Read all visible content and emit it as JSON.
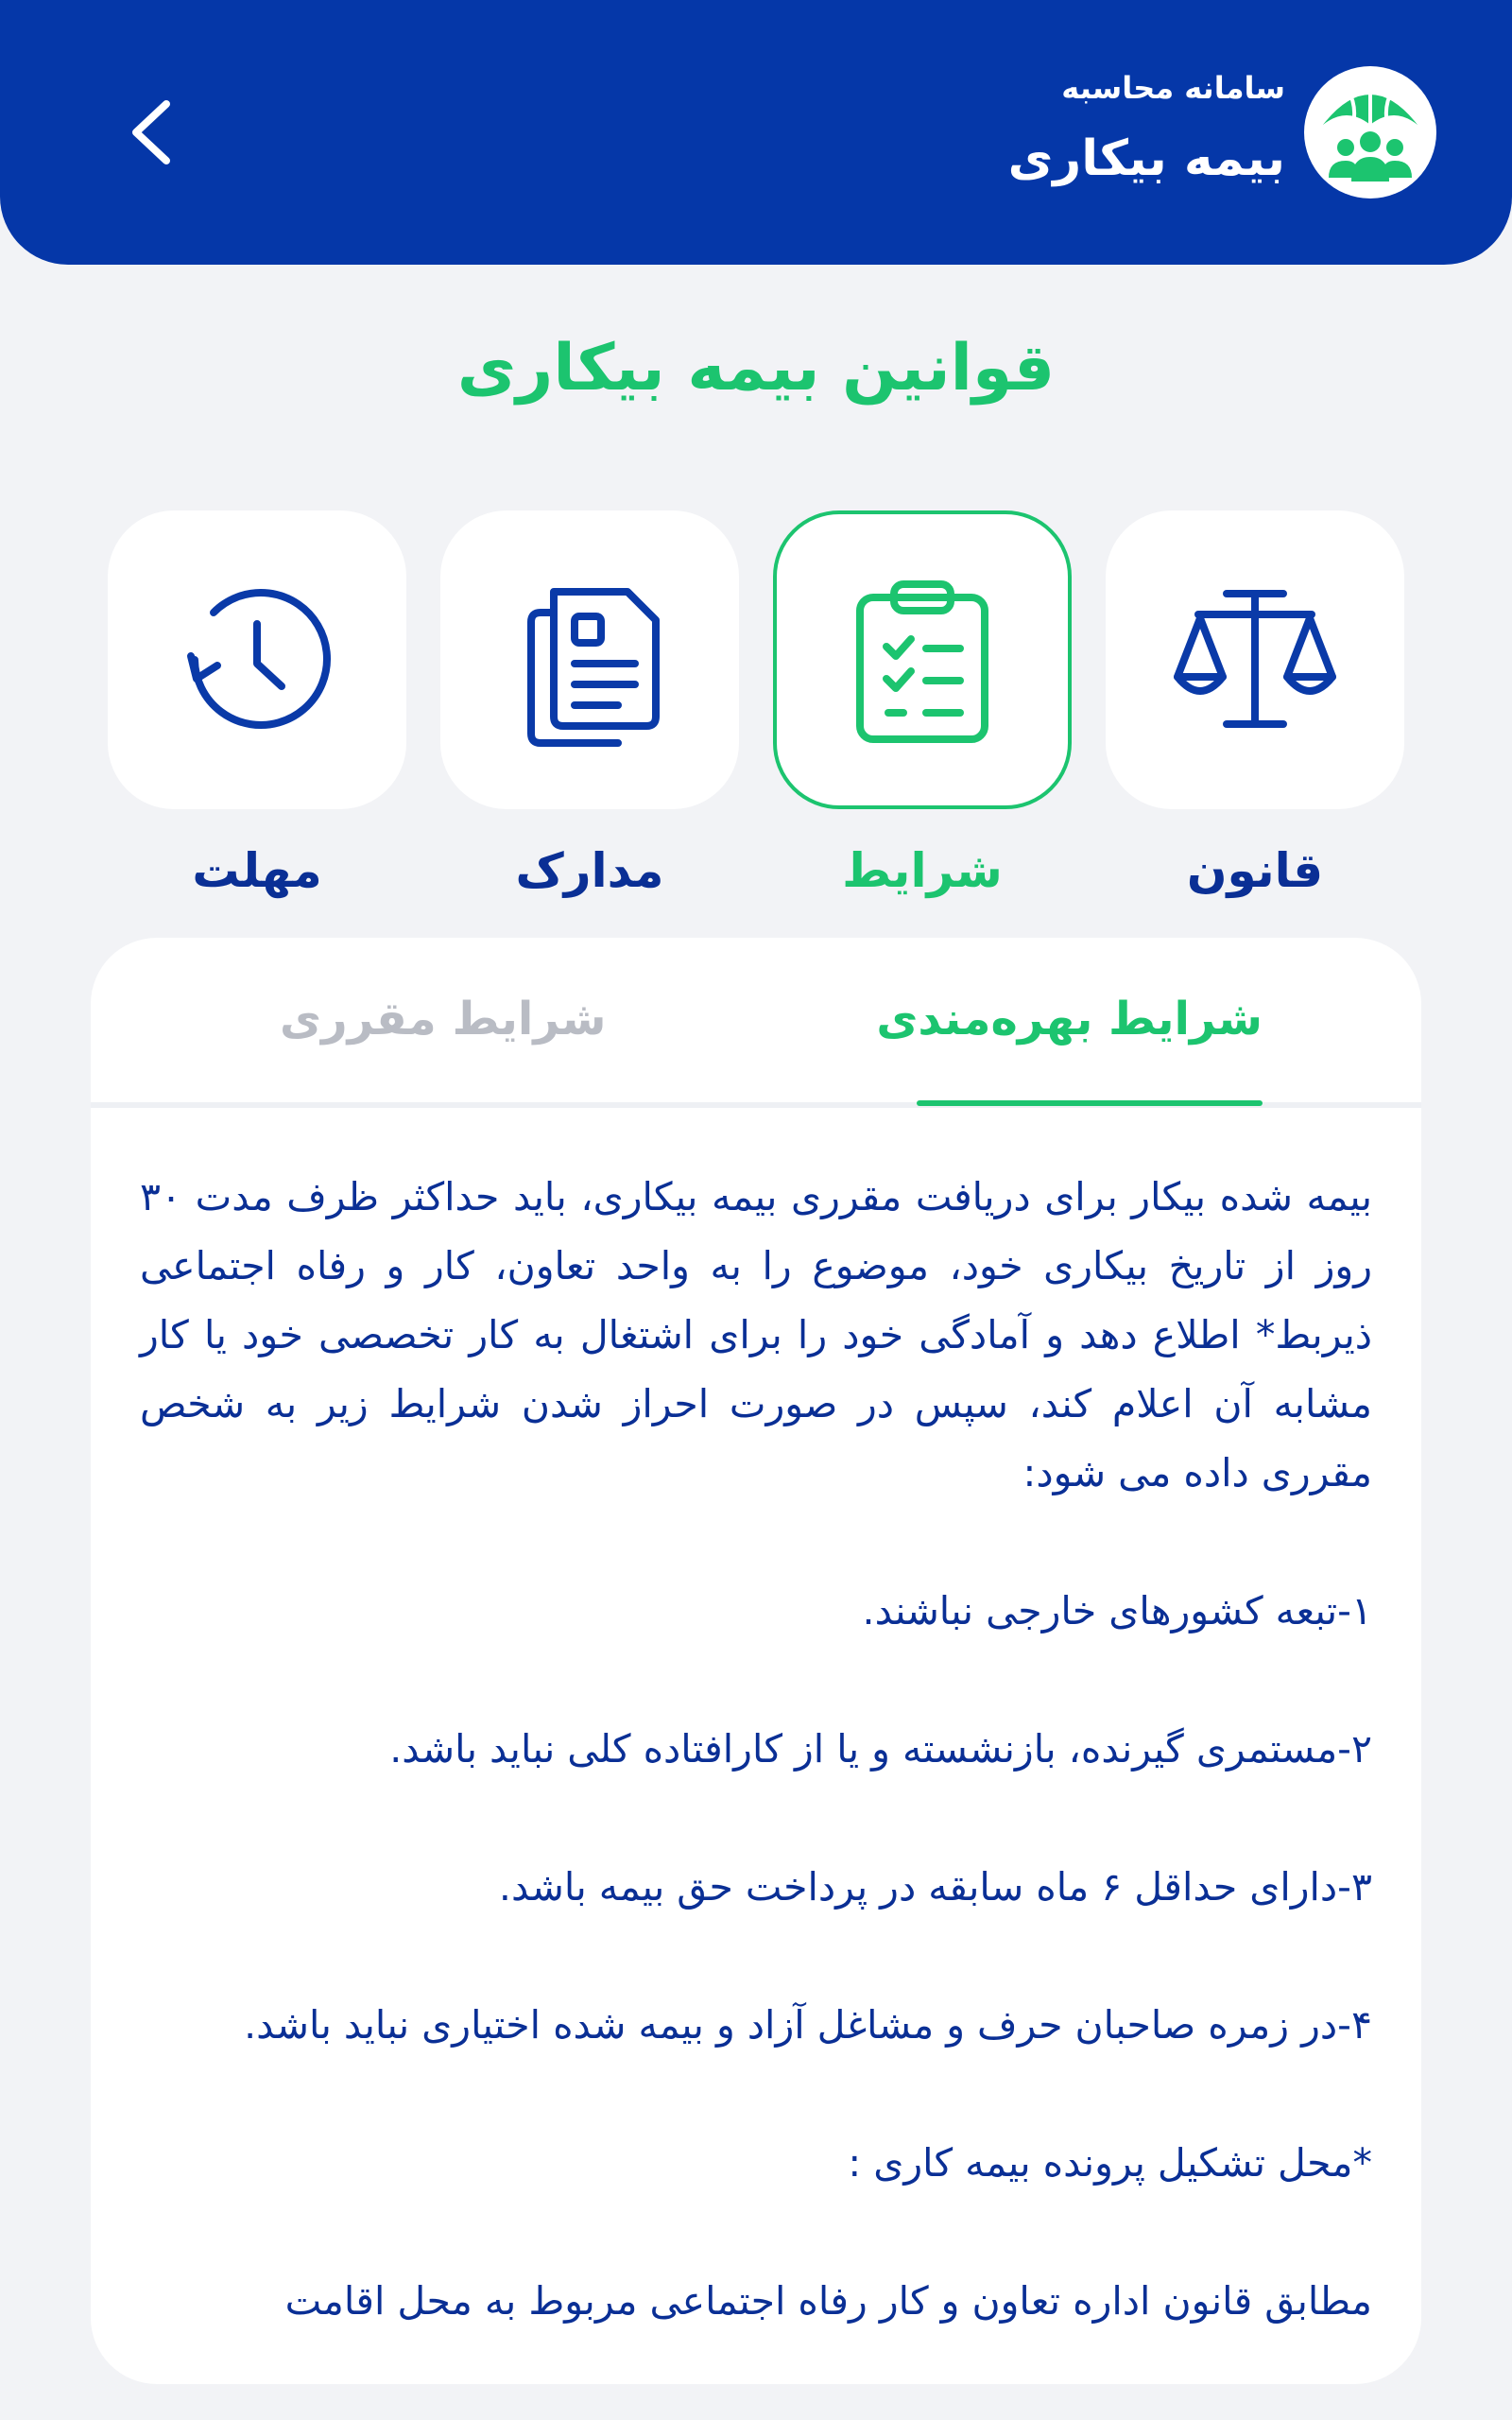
{
  "header": {
    "subtitle": "سامانه محاسبه",
    "title": "بیمه بیکاری"
  },
  "page": {
    "title": "قوانین بیمه بیکاری"
  },
  "categories": [
    {
      "label": "قانون",
      "icon": "scale-icon",
      "active": false
    },
    {
      "label": "شرایط",
      "icon": "clipboard-checklist-icon",
      "active": true
    },
    {
      "label": "مدارک",
      "icon": "documents-icon",
      "active": false
    },
    {
      "label": "مهلت",
      "icon": "history-clock-icon",
      "active": false
    }
  ],
  "tabs": {
    "active": "شرایط بهره‌مندی",
    "inactive": "شرایط مقرری"
  },
  "content": {
    "intro": "بیمه شده بیکار برای دریافت مقرری بیمه بیکاری، باید حداکثر ظرف مدت ۳۰ روز از تاریخ بیکاری خود، موضوع را به واحد تعاون، کار و رفاه اجتماعی ذیربط* اطلاع دهد و آمادگی خود را برای اشتغال به کار تخصصی خود یا کار مشابه آن اعلام کند، سپس در صورت احراز شدن شرایط زیر به شخص مقرری داده می شود:",
    "items": [
      "۱-تبعه کشورهای خارجی نباشند.",
      "۲-مستمری گیرنده، بازنشسته و یا از کارافتاده کلی نباید باشد.",
      "۳-دارای حداقل ۶ ماه سابقه در پرداخت حق بیمه باشد.",
      "۴-در زمره صاحبان حرف و مشاغل آزاد و بیمه شده اختیاری نباید باشد.",
      "*محل تشکیل پرونده بیمه کاری :"
    ],
    "last": "مطابق قانون اداره تعاون و کار رفاه اجتماعی مربوط به محل اقامت"
  },
  "colors": {
    "header_bg": "#0537a8",
    "accent_green": "#1cc46f",
    "text_blue": "#0a2f95",
    "inactive_gray": "#b9bcc4",
    "page_bg": "#f2f3f6"
  }
}
